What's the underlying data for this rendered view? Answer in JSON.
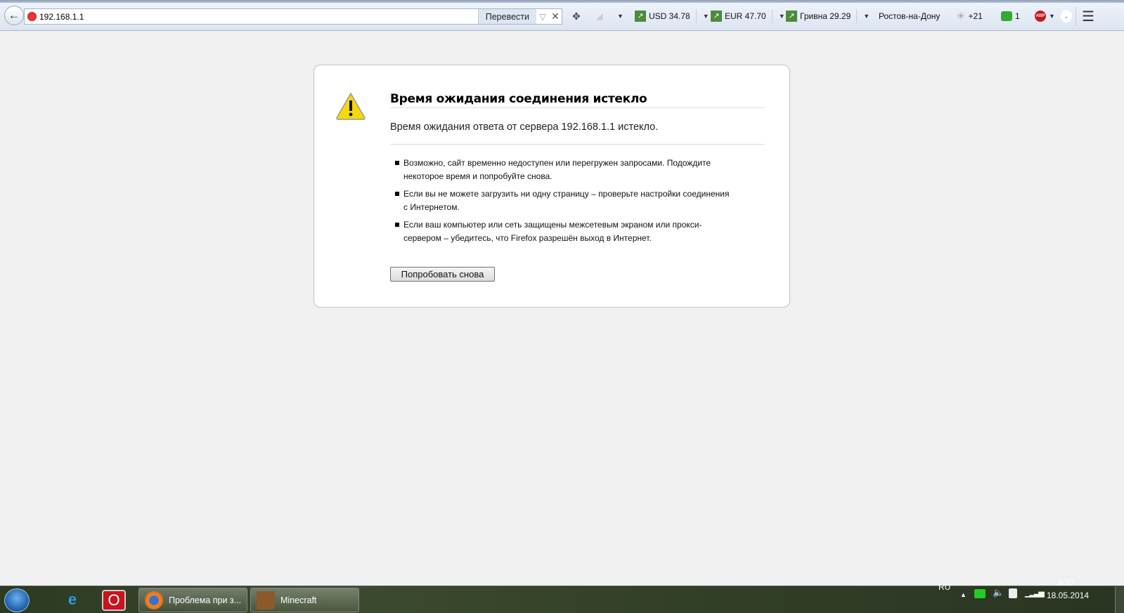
{
  "browser": {
    "url": "192.168.1.1",
    "translate_label": "Перевести",
    "toolbar": {
      "usd": "USD 34.78",
      "eur": "EUR 47.70",
      "uah": "Гривна 29.29",
      "city": "Ростов-на-Дону",
      "weather": "+21",
      "mail_count": "1",
      "adblock": "ABP"
    }
  },
  "error_page": {
    "title": "Время ожидания соединения истекло",
    "subtitle": "Время ожидания ответа от сервера 192.168.1.1 истекло.",
    "bullets": [
      "Возможно, сайт временно недоступен или перегружен запросами. Подождите некоторое время и попробуйте снова.",
      "Если вы не можете загрузить ни одну страницу – проверьте настройки соединения с Интернетом.",
      "Если ваш компьютер или сеть защищены межсетевым экраном или прокси-сервером – убедитесь, что Firefox разрешён выход в Интернет."
    ],
    "retry_label": "Попробовать снова"
  },
  "taskbar": {
    "tasks": [
      {
        "label": "Проблема при з..."
      },
      {
        "label": "Minecraft"
      }
    ],
    "language": "RU",
    "time": "9:37",
    "date": "18.05.2014"
  }
}
